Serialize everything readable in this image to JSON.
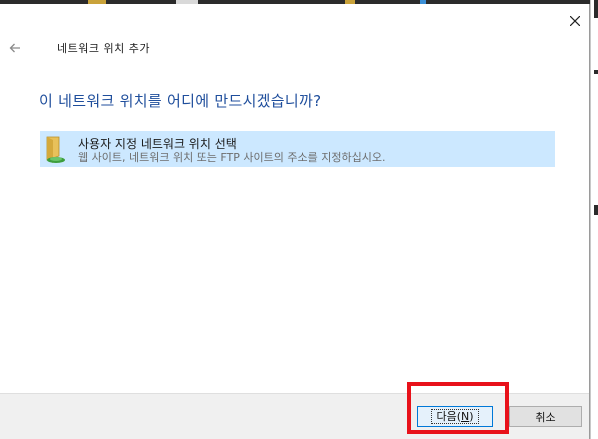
{
  "window": {
    "title": "네트워크 위치 추가",
    "close_icon": "close-icon",
    "back_icon": "back-arrow-icon"
  },
  "heading": "이 네트워크 위치를 어디에 만드시겠습니까?",
  "options": [
    {
      "title": "사용자 지정 네트워크 위치 선택",
      "description": "웹 사이트, 네트워크 위치 또는 FTP 사이트의 주소를 지정하십시오.",
      "icon": "network-folder-icon",
      "selected": true
    }
  ],
  "footer": {
    "next_label": "다음(",
    "next_mnemonic": "N",
    "next_suffix": ")",
    "cancel_label": "취소"
  },
  "colors": {
    "heading": "#1f4e9c",
    "selection": "#cce8ff",
    "highlight_box": "#e8111a"
  }
}
